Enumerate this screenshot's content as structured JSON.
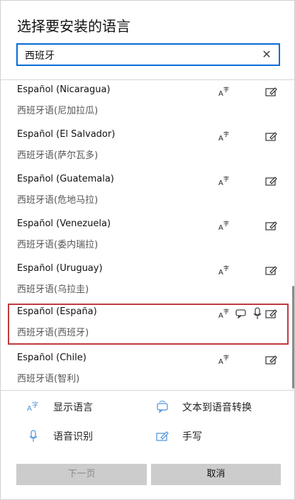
{
  "dialog": {
    "title": "选择要安装的语言"
  },
  "search": {
    "value": "西班牙",
    "clear_glyph": "✕"
  },
  "languages": [
    {
      "name": "Español (Nicaragua)",
      "native": "西班牙语(尼加拉瓜)",
      "features": [
        "display-language",
        "handwriting"
      ]
    },
    {
      "name": "Español (El Salvador)",
      "native": "西班牙语(萨尔瓦多)",
      "features": [
        "display-language",
        "handwriting"
      ]
    },
    {
      "name": "Español (Guatemala)",
      "native": "西班牙语(危地马拉)",
      "features": [
        "display-language",
        "handwriting"
      ]
    },
    {
      "name": "Español (Venezuela)",
      "native": "西班牙语(委内瑞拉)",
      "features": [
        "display-language",
        "handwriting"
      ]
    },
    {
      "name": "Español (Uruguay)",
      "native": "西班牙语(乌拉圭)",
      "features": [
        "display-language",
        "handwriting"
      ]
    },
    {
      "name": "Español (España)",
      "native": "西班牙语(西班牙)",
      "features": [
        "display-language",
        "text-to-speech",
        "speech-recognition",
        "handwriting"
      ],
      "selected": true
    },
    {
      "name": "Español (Chile)",
      "native": "西班牙语(智利)",
      "features": [
        "display-language",
        "handwriting"
      ]
    }
  ],
  "legend": {
    "display_language": "显示语言",
    "text_to_speech": "文本到语音转换",
    "speech_recognition": "语音识别",
    "handwriting": "手写"
  },
  "buttons": {
    "next": "下一页",
    "cancel": "取消"
  },
  "colors": {
    "accent": "#0a6cd6",
    "selection_border": "#c03a3f",
    "legend_icon": "#4a90d9"
  }
}
